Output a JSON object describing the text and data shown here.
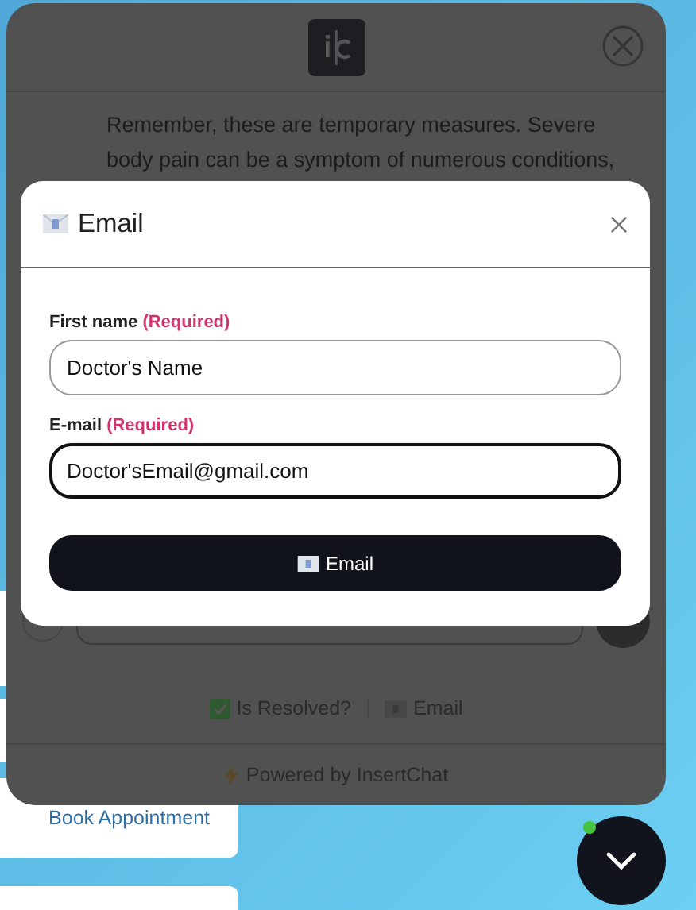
{
  "background": {
    "card_link": "Book Appointment"
  },
  "chat": {
    "messages": [
      "Remember, these are temporary measures. Severe body pain can be a symptom of numerous conditions,"
    ],
    "actions": [
      "Is Resolved?",
      "Email"
    ],
    "footer": "Powered by InsertChat"
  },
  "modal": {
    "title": "Email",
    "fields": [
      {
        "label": "First name",
        "required": "(Required)",
        "value": "Doctor's Name",
        "focused": false
      },
      {
        "label": "E-mail",
        "required": "(Required)",
        "value": "Doctor'sEmail@gmail.com",
        "focused": true
      }
    ],
    "submit": "Email"
  },
  "launcher": {
    "online": true
  }
}
